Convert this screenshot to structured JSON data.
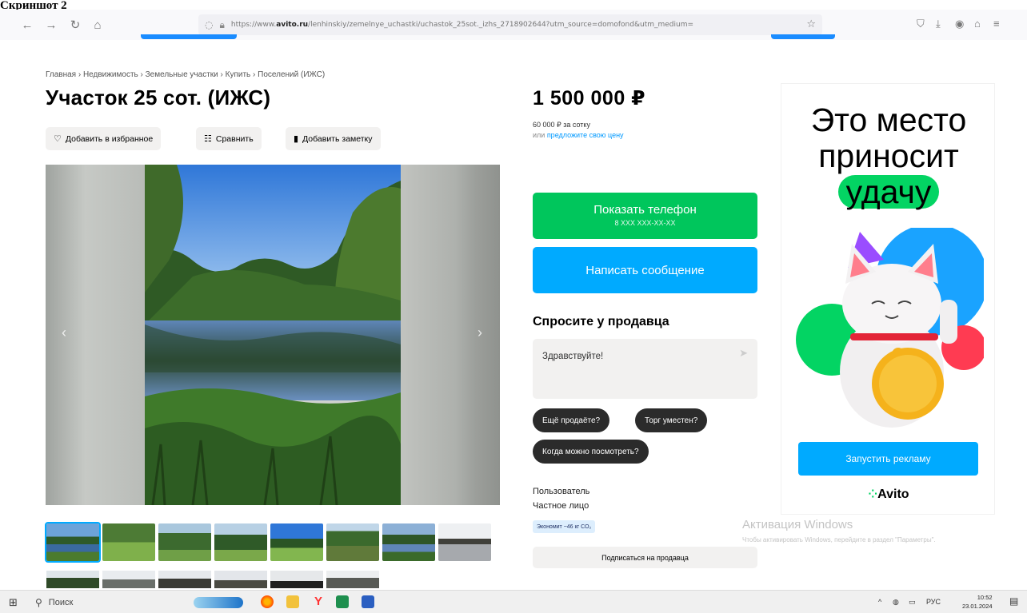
{
  "doc_label": "Скриншот 2",
  "browser": {
    "url_prefix": "https://www.",
    "url_domain": "avito.ru",
    "url_rest": "/lenhinskiy/zemelnye_uchastki/uchastok_25sot._izhs_2718902644?utm_source=domofond&utm_medium=",
    "icons": [
      "back-icon",
      "forward-icon",
      "reload-icon",
      "home-icon",
      "shield-icon",
      "lock-icon",
      "bookmark-star-icon",
      "pocket-icon",
      "download-icon",
      "account-icon",
      "extensions-icon",
      "menu-icon"
    ]
  },
  "breadcrumbs": "Главная › Недвижимость › Земельные участки › Купить › Поселений (ИЖС)",
  "title": "Участок 25 сот. (ИЖС)",
  "actions": {
    "favorite": "Добавить в избранное",
    "compare": "Сравнить",
    "note": "Добавить заметку"
  },
  "price": {
    "value": "1 500 000 ₽",
    "per_unit": "60 000 ₽ за сотку",
    "offer_prefix": "или ",
    "offer_link": "предложите свою цену"
  },
  "contact": {
    "show_phone": "Показать телефон",
    "phone_mask": "8 XXX XXX-XX-XX",
    "write_message": "Написать сообщение"
  },
  "ask": {
    "title": "Спросите у продавца",
    "message": "Здравствуйте!",
    "chips": [
      "Ещё продаёте?",
      "Торг уместен?",
      "Когда можно посмотреть?"
    ]
  },
  "seller": {
    "name": "Пользователь",
    "type": "Частное лицо",
    "eco": "Экономит ~46 кг CO₂",
    "subscribe": "Подписаться на продавца"
  },
  "ad": {
    "line1": "Это место",
    "line2": "приносит",
    "line3": "удачу",
    "button": "Запустить рекламу",
    "logo": "Avito"
  },
  "windows_activation": {
    "title": "Активация Windows",
    "hint": "Чтобы активировать Windows, перейдите в раздел \"Параметры\"."
  },
  "taskbar": {
    "search": "Поиск",
    "lang": "РУС",
    "time": "10:52",
    "date": "23.01.2024"
  },
  "colors": {
    "green": "#00c65c",
    "blue": "#00aaff",
    "chip_dark": "#2b2b2b",
    "ad_green": "#03d463"
  }
}
